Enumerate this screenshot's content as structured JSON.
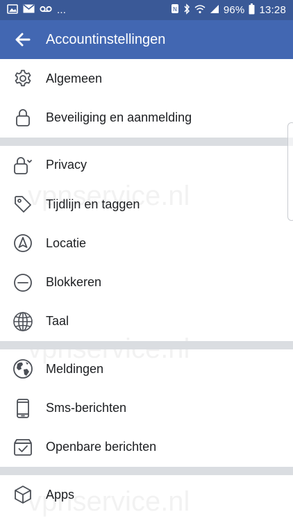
{
  "status_bar": {
    "left_text": "...",
    "battery": "96%",
    "time": "13:28"
  },
  "app_bar": {
    "title": "Accountinstellingen"
  },
  "sections": [
    [
      {
        "label": "Algemeen",
        "icon": "gear-icon"
      },
      {
        "label": "Beveiliging en aanmelding",
        "icon": "lock-icon"
      }
    ],
    [
      {
        "label": "Privacy",
        "icon": "privacy-lock-icon"
      },
      {
        "label": "Tijdlijn en taggen",
        "icon": "tag-icon"
      },
      {
        "label": "Locatie",
        "icon": "location-arrow-icon"
      },
      {
        "label": "Blokkeren",
        "icon": "block-icon"
      },
      {
        "label": "Taal",
        "icon": "globe-icon"
      }
    ],
    [
      {
        "label": "Meldingen",
        "icon": "earth-icon"
      },
      {
        "label": "Sms-berichten",
        "icon": "phone-icon"
      },
      {
        "label": "Openbare berichten",
        "icon": "inbox-check-icon"
      }
    ],
    [
      {
        "label": "Apps",
        "icon": "cube-icon"
      }
    ]
  ],
  "watermark": "vpnservice.nl",
  "colors": {
    "status_bar": "#3a5997",
    "app_bar": "#4267b2",
    "divider": "#dadde1",
    "text": "#1c1e21",
    "icon": "#4b4f56"
  }
}
